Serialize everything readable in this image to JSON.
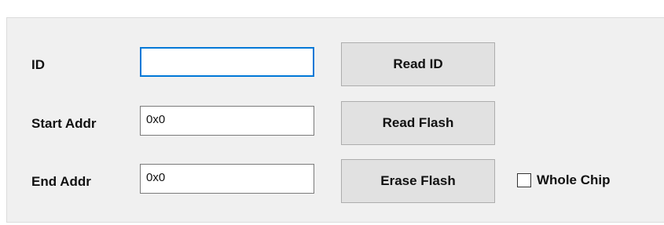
{
  "form": {
    "id_label": "ID",
    "id_value": "",
    "start_addr_label": "Start Addr",
    "start_addr_value": "0x0",
    "end_addr_label": "End Addr",
    "end_addr_value": "0x0"
  },
  "buttons": {
    "read_id": "Read ID",
    "read_flash": "Read Flash",
    "erase_flash": "Erase Flash"
  },
  "whole_chip": {
    "label": "Whole Chip",
    "checked": false
  },
  "colors": {
    "panel_background": "#f0f0f0",
    "focus_border": "#0078d7",
    "button_face": "#e1e1e1"
  }
}
